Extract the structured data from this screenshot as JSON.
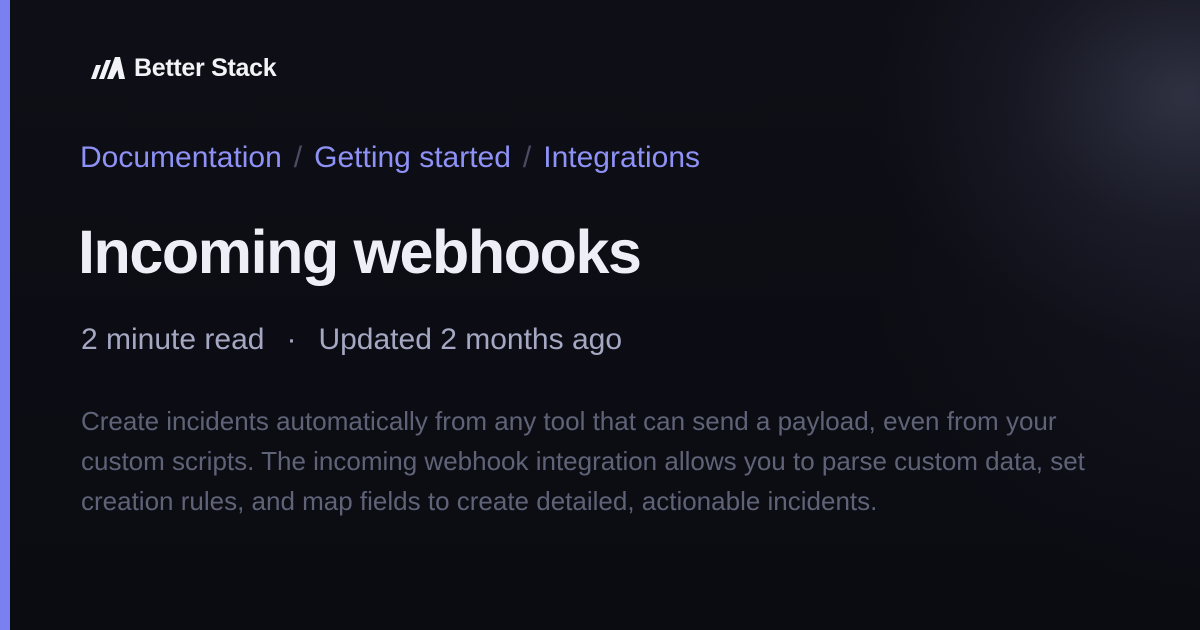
{
  "brand": {
    "name": "Better Stack",
    "accent_color": "#7b80f0",
    "logo_icon": "better-stack-logo-icon"
  },
  "breadcrumb": {
    "items": [
      "Documentation",
      "Getting started",
      "Integrations"
    ],
    "separator": "/"
  },
  "page": {
    "title": "Incoming webhooks",
    "read_time": "2 minute read",
    "meta_separator": "·",
    "updated": "Updated 2 months ago",
    "description": "Create incidents automatically from any tool that can send a payload, even from your custom scripts. The incoming webhook integration allows you to parse custom data, set creation rules, and map fields to create detailed, actionable incidents."
  }
}
